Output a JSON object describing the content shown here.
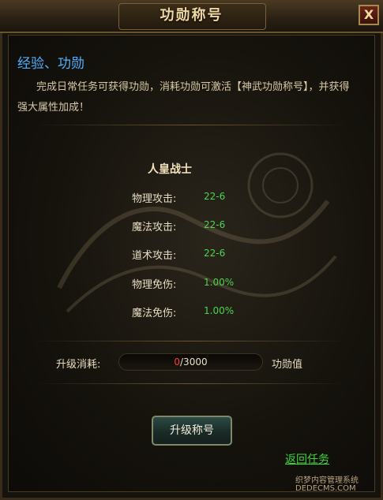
{
  "window": {
    "title": "功勋称号",
    "close_label": "X"
  },
  "header": {
    "title": "经验、功勋",
    "description": "完成日常任务可获得功勋，消耗功勋可激活【神武功勋称号】，并获得强大属性加成！"
  },
  "rank": {
    "name": "人皇战士",
    "stats": [
      {
        "label": "物理攻击:",
        "value": "22-6"
      },
      {
        "label": "魔法攻击:",
        "value": "22-6"
      },
      {
        "label": "道术攻击:",
        "value": "22-6"
      },
      {
        "label": "物理免伤:",
        "value": "1.00%"
      },
      {
        "label": "魔法免伤:",
        "value": "1.00%"
      }
    ]
  },
  "cost": {
    "label": "升级消耗:",
    "current": "0",
    "total": "/3000",
    "unit": "功勋值"
  },
  "actions": {
    "upgrade_label": "升级称号",
    "return_label": "返回任务"
  },
  "watermark": {
    "line1": "织梦内容管理系统",
    "line2": "DEDECMS.COM"
  },
  "colors": {
    "header": "#4fb0ff",
    "stat_value": "#4cd64c",
    "cost_current": "#ff3b30",
    "link": "#39d839"
  }
}
